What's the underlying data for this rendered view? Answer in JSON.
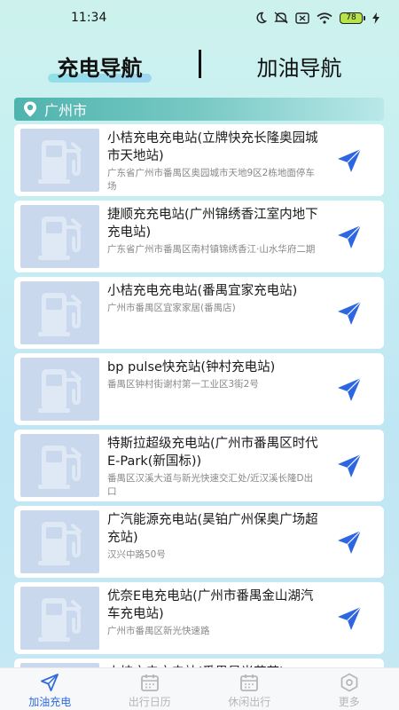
{
  "status_bar": {
    "time": "11:34",
    "battery": "78",
    "icons": [
      "moon-icon",
      "mute-icon",
      "sim-off-icon",
      "wifi-icon",
      "battery-icon",
      "charging-icon"
    ]
  },
  "top_tabs": [
    {
      "label": "充电导航",
      "active": true
    },
    {
      "label": "加油导航",
      "active": false
    }
  ],
  "city": {
    "icon": "location-pin-icon",
    "name": "广州市"
  },
  "stations": [
    {
      "name": "小桔充电充电站(立牌快充长隆奥园城市天地站)",
      "address": "广东省广州市番禺区奥园城市天地9区2栋地面停车场"
    },
    {
      "name": "捷顺充充电站(广州锦绣香江室内地下充电站)",
      "address": "广东省广州市番禺区南村镇锦绣香江·山水华府二期"
    },
    {
      "name": "小桔充电充电站(番禺宜家充电站)",
      "address": "广州市番禺区宜家家居(番禺店)"
    },
    {
      "name": "bp pulse快充站(钟村充电站)",
      "address": "番禺区钟村街谢村第一工业区3街2号"
    },
    {
      "name": "特斯拉超级充电站(广州市番禺区时代E-Park(新国标))",
      "address": "番禺区汉溪大道与新光快速交汇处/近汉溪长隆D出口"
    },
    {
      "name": "广汽能源充电站(昊铂广州保奥广场超充站)",
      "address": "汉兴中路50号"
    },
    {
      "name": "优奈E电充电站(广州市番禺金山湖汽车充电站)",
      "address": "广州市番禺区新光快速路"
    },
    {
      "name": "小桔充电充电站(番禺星光花苑)",
      "address": ""
    }
  ],
  "bottom_nav": [
    {
      "label": "加油充电",
      "icon": "navigate-arrow-icon",
      "active": true
    },
    {
      "label": "出行日历",
      "icon": "calendar-icon",
      "active": false
    },
    {
      "label": "休闲出行",
      "icon": "calendar-icon",
      "active": false
    },
    {
      "label": "更多",
      "icon": "hexagon-icon",
      "active": false
    }
  ],
  "colors": {
    "accent": "#2f6bdc",
    "nav_arrow": "#2d66e0",
    "city_bar": "#4fb3ae",
    "thumb_bg": "#c9d8ed"
  }
}
